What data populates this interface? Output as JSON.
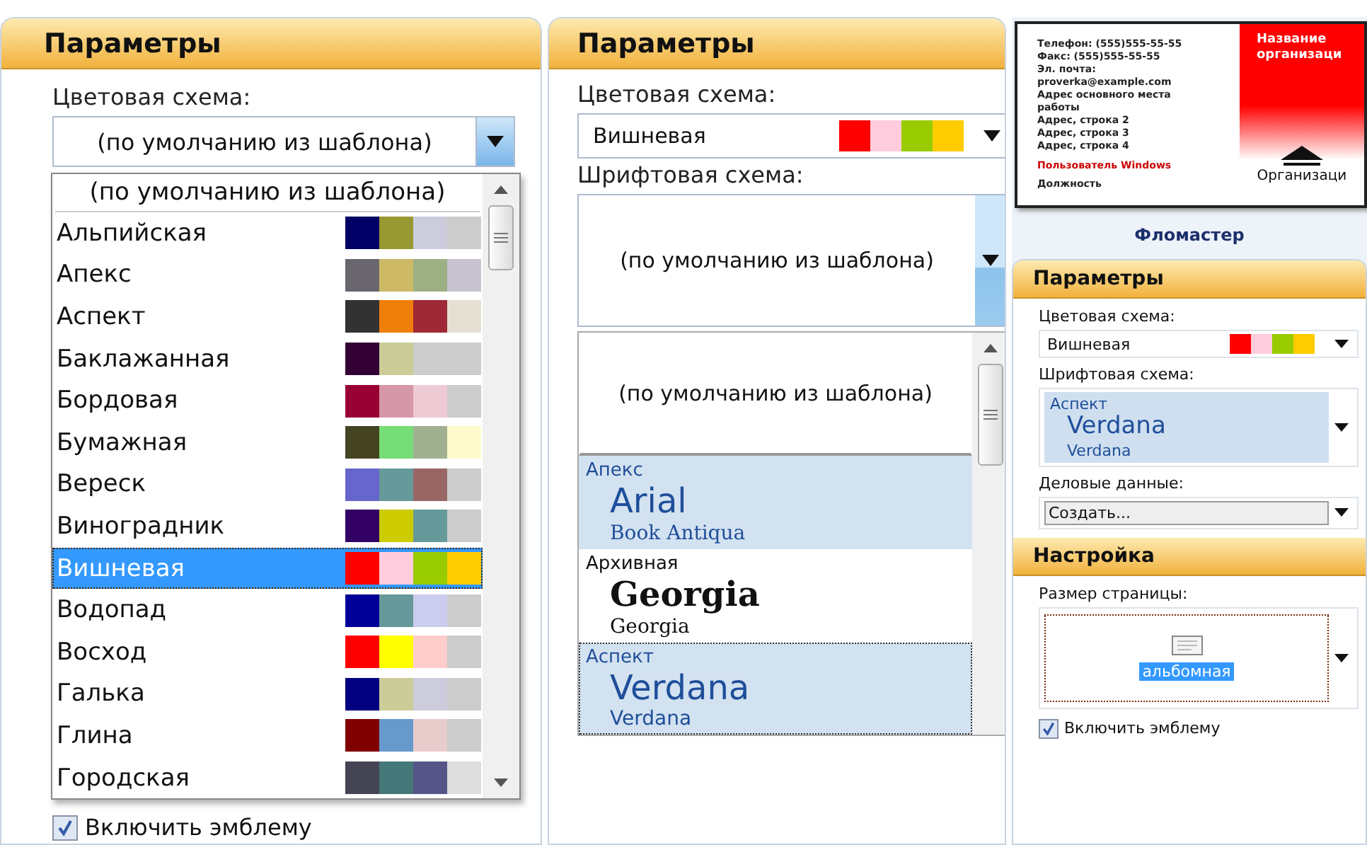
{
  "left_panel": {
    "header": "Параметры",
    "color_scheme": {
      "label": "Цветовая схема:",
      "value": "(по умолчанию из шаблона)",
      "open": true
    },
    "color_list": {
      "default_item": "(по умолчанию из шаблона)",
      "items": [
        {
          "name": "Альпийская",
          "swatches": [
            {
              "color": "#000066"
            },
            {
              "color": "#999933"
            },
            {
              "color": "#ccccdd"
            },
            {
              "color": "#cccccc"
            }
          ],
          "selected": false
        },
        {
          "name": "Апекс",
          "swatches": [
            {
              "color": "#69676d"
            },
            {
              "color": "#ceb966"
            },
            {
              "color": "#9cb084"
            },
            {
              "color": "#c9c2d1"
            }
          ],
          "selected": false
        },
        {
          "name": "Аспект",
          "swatches": [
            {
              "color": "#323232"
            },
            {
              "color": "#f07f09"
            },
            {
              "color": "#9f2936"
            },
            {
              "color": "#e5dfd4"
            }
          ],
          "selected": false
        },
        {
          "name": "Баклажанная",
          "swatches": [
            {
              "color": "#330033"
            },
            {
              "color": "#cccc99"
            },
            {
              "color": "#cccccc"
            },
            {
              "color": "#cccccc"
            }
          ],
          "selected": false
        },
        {
          "name": "Бордовая",
          "swatches": [
            {
              "color": "#990033"
            },
            {
              "color": "#d697a9"
            },
            {
              "color": "#eecad5"
            },
            {
              "color": "#cccccc"
            }
          ],
          "selected": false
        },
        {
          "name": "Бумажная",
          "swatches": [
            {
              "color": "#444422"
            },
            {
              "color": "#77dd77"
            },
            {
              "color": "#a0b090"
            },
            {
              "color": "#fffacd"
            }
          ],
          "selected": false
        },
        {
          "name": "Вереск",
          "swatches": [
            {
              "color": "#6666cc"
            },
            {
              "color": "#669999"
            },
            {
              "color": "#996666"
            },
            {
              "color": "#cccccc"
            }
          ],
          "selected": false
        },
        {
          "name": "Виноградник",
          "swatches": [
            {
              "color": "#330066"
            },
            {
              "color": "#cccc00"
            },
            {
              "color": "#669999"
            },
            {
              "color": "#cccccc"
            }
          ],
          "selected": false
        },
        {
          "name": "Вишневая",
          "swatches": [
            {
              "color": "#ff0000"
            },
            {
              "color": "#ffccdd"
            },
            {
              "color": "#99cc00"
            },
            {
              "color": "#ffcc00"
            }
          ],
          "selected": true
        },
        {
          "name": "Водопад",
          "swatches": [
            {
              "color": "#000099"
            },
            {
              "color": "#669999"
            },
            {
              "color": "#ccccee"
            },
            {
              "color": "#cccccc"
            }
          ],
          "selected": false
        },
        {
          "name": "Восход",
          "swatches": [
            {
              "color": "#ff0000"
            },
            {
              "color": "#ffff00"
            },
            {
              "color": "#ffcccc"
            },
            {
              "color": "#cccccc"
            }
          ],
          "selected": false
        },
        {
          "name": "Галька",
          "swatches": [
            {
              "color": "#000080"
            },
            {
              "color": "#cccc99"
            },
            {
              "color": "#ccccdd"
            },
            {
              "color": "#cccccc"
            }
          ],
          "selected": false
        },
        {
          "name": "Глина",
          "swatches": [
            {
              "color": "#800000"
            },
            {
              "color": "#6699cc"
            },
            {
              "color": "#e8cccc"
            },
            {
              "color": "#cccccc"
            }
          ],
          "selected": false
        },
        {
          "name": "Городская",
          "swatches": [
            {
              "color": "#444455"
            },
            {
              "color": "#447777"
            },
            {
              "color": "#555588"
            },
            {
              "color": "#dddddd"
            }
          ],
          "selected": false
        }
      ]
    },
    "logo_checkbox": {
      "label": "Включить эмблему",
      "checked": true
    }
  },
  "middle_panel": {
    "header": "Параметры",
    "color_scheme": {
      "label": "Цветовая схема:",
      "value": "Вишневая",
      "swatches": [
        {
          "color": "#ff0000"
        },
        {
          "color": "#ffccdd"
        },
        {
          "color": "#99cc00"
        },
        {
          "color": "#ffcc00"
        }
      ]
    },
    "font_scheme": {
      "label": "Шрифтовая схема:",
      "value": "(по умолчанию из шаблона)",
      "open": true
    },
    "font_list": [
      {
        "kind": "default",
        "name": "(по умолчанию из шаблона)",
        "highlighted": false,
        "focused": false
      },
      {
        "kind": "scheme",
        "name": "Апекс",
        "heading": {
          "kind": "sans",
          "text": "Arial"
        },
        "body": {
          "kind": "serif",
          "text": "Book Antiqua"
        },
        "highlighted": true,
        "focused": false
      },
      {
        "kind": "scheme",
        "name": "Архивная",
        "heading": {
          "kind": "serif-bold",
          "text": "Georgia"
        },
        "body": {
          "kind": "serif",
          "text": "Georgia"
        },
        "highlighted": false,
        "focused": false
      },
      {
        "kind": "scheme",
        "name": "Аспект",
        "heading": {
          "kind": "sans",
          "text": "Verdana"
        },
        "body": {
          "kind": "sans",
          "text": "Verdana"
        },
        "highlighted": true,
        "focused": true
      }
    ]
  },
  "right_panel": {
    "preview": {
      "contact_lines": [
        "Телефон: (555)555-55-55",
        "Факс: (555)555-55-55",
        "Эл. почта:",
        "proverka@example.com",
        "Адрес основного места",
        "работы",
        "Адрес, строка 2",
        "Адрес, строка 3",
        "Адрес, строка 4"
      ],
      "user_name": "Пользователь Windows",
      "job_title": "Должность",
      "org_name_lines": [
        "Название",
        "организаци"
      ],
      "org_logo_text": "Организаци"
    },
    "caption": "Фломастер",
    "header": "Параметры",
    "color_scheme": {
      "label": "Цветовая схема:",
      "value": "Вишневая",
      "swatches": [
        {
          "color": "#ff0000"
        },
        {
          "color": "#ffccdd"
        },
        {
          "color": "#99cc00"
        },
        {
          "color": "#ffcc00"
        }
      ]
    },
    "font_scheme": {
      "label": "Шрифтовая схема:",
      "name": "Аспект",
      "heading": {
        "kind": "sans",
        "text": "Verdana"
      },
      "body": {
        "kind": "sans",
        "text": "Verdana"
      }
    },
    "business_data": {
      "label": "Деловые данные:",
      "value": "Создать..."
    },
    "settings_header": "Настройка",
    "page_size": {
      "label": "Размер страницы:",
      "value": "альбомная",
      "selected": true
    },
    "logo_checkbox": {
      "label": "Включить эмблему",
      "checked": true
    }
  }
}
